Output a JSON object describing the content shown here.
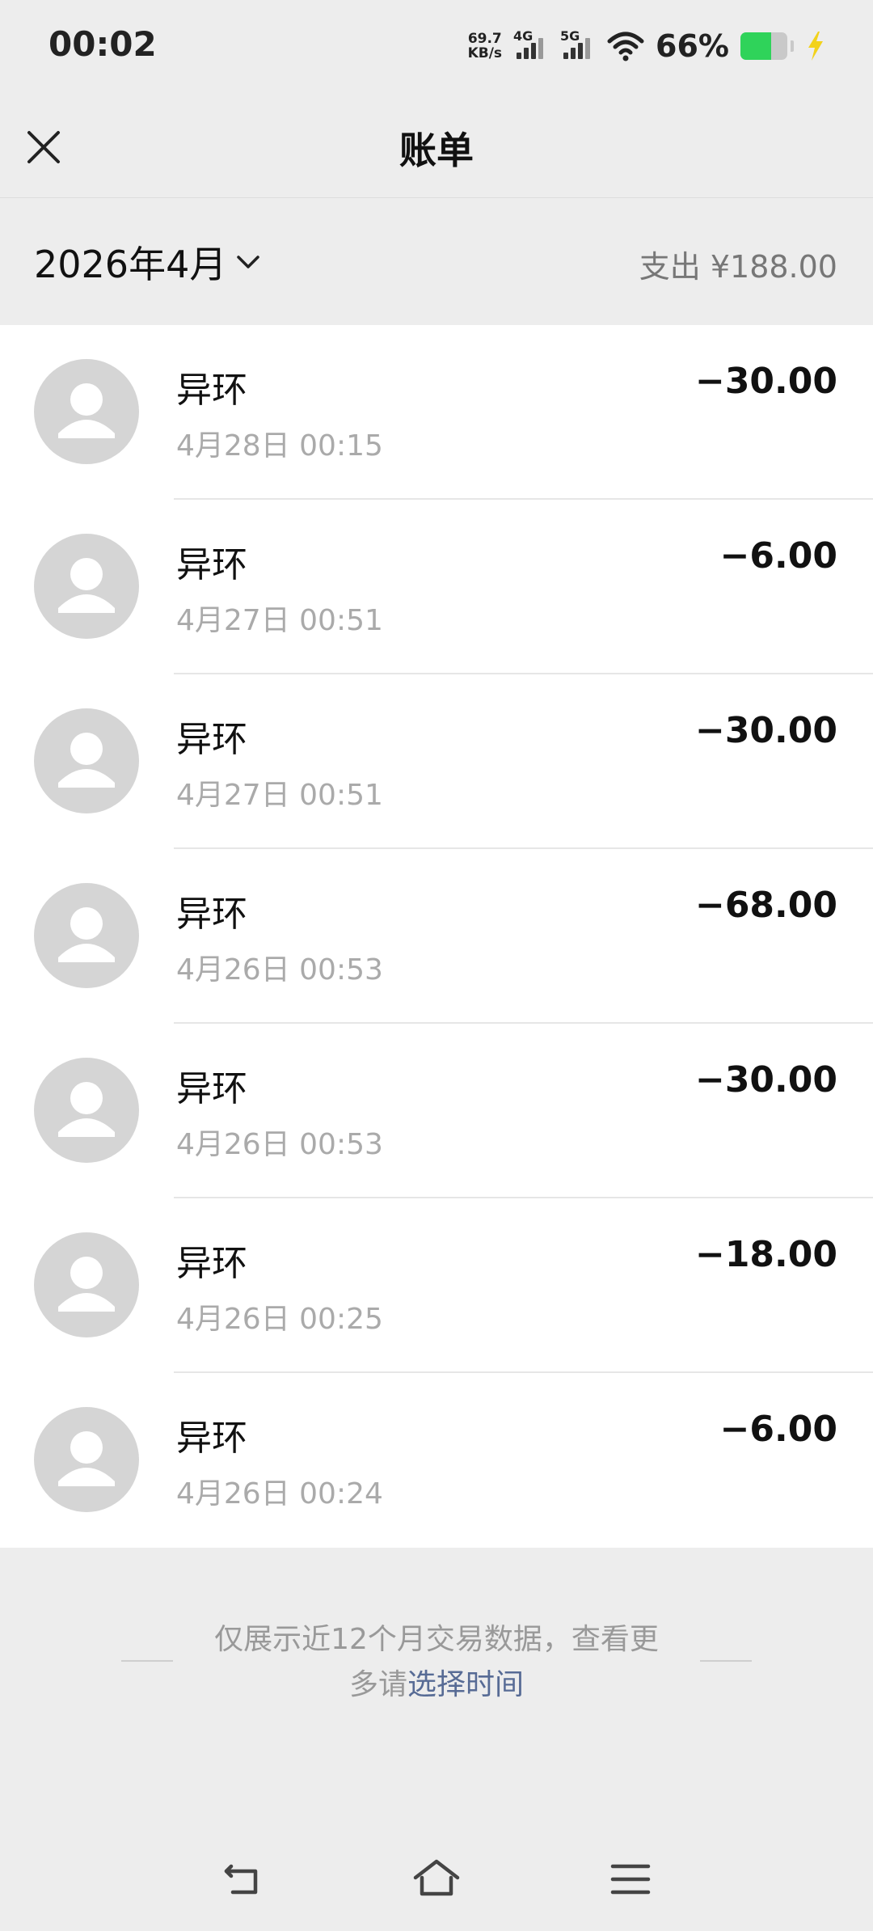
{
  "status_bar": {
    "time": "00:02",
    "net_speed_value": "69.7",
    "net_speed_unit": "KB/s",
    "sim1_label": "4G",
    "sim2_label": "5G",
    "battery_percent": "66%",
    "battery_level": 0.66,
    "battery_color": "#2fd35a"
  },
  "header": {
    "title": "账单",
    "close_icon": "close-icon"
  },
  "month_bar": {
    "month": "2026年4月",
    "summary": "支出 ¥188.00"
  },
  "transactions": [
    {
      "name": "异环",
      "time": "4月28日 00:15",
      "amount": "−30.00"
    },
    {
      "name": "异环",
      "time": "4月27日 00:51",
      "amount": "−6.00"
    },
    {
      "name": "异环",
      "time": "4月27日 00:51",
      "amount": "−30.00"
    },
    {
      "name": "异环",
      "time": "4月26日 00:53",
      "amount": "−68.00"
    },
    {
      "name": "异环",
      "time": "4月26日 00:53",
      "amount": "−30.00"
    },
    {
      "name": "异环",
      "time": "4月26日 00:25",
      "amount": "−18.00"
    },
    {
      "name": "异环",
      "time": "4月26日 00:24",
      "amount": "−6.00"
    }
  ],
  "footer": {
    "note_line1": "仅展示近12个月交易数据，查看更",
    "note_line2_prefix": "多请",
    "note_link": "选择时间",
    "link_color": "#576b95"
  },
  "nav_bar": {
    "back_icon": "back-icon",
    "home_icon": "home-icon",
    "menu_icon": "menu-icon"
  }
}
